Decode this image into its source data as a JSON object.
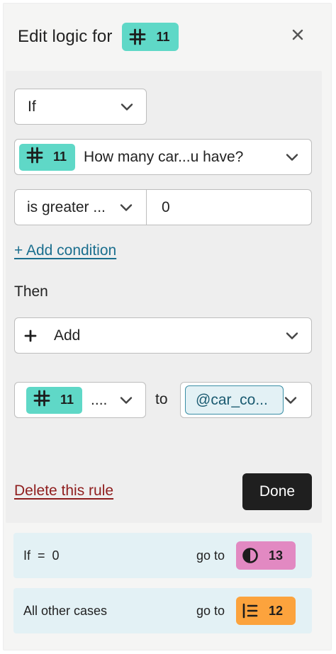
{
  "header": {
    "title": "Edit logic for",
    "question_number": "11",
    "question_icon": "hash-icon",
    "close_icon": "close-icon"
  },
  "rule": {
    "if_select": "If",
    "condition_question": {
      "number": "11",
      "icon": "hash-icon",
      "label": "How many car...u have?"
    },
    "operator": "is greater ...",
    "value": "0",
    "add_condition": "+ Add condition",
    "then_label": "Then",
    "action_add": "Add",
    "action_add_icon": "plus-icon",
    "variable_row": {
      "question_number": "11",
      "question_icon": "hash-icon",
      "field_text": "....",
      "to_label": "to",
      "target_variable": "@car_co..."
    },
    "delete_label": "Delete this rule",
    "done_label": "Done"
  },
  "summaries": [
    {
      "condition": "If  =  0",
      "goto_label": "go to",
      "target_number": "13",
      "target_icon": "half-circle-icon",
      "target_color": "#e289c2"
    },
    {
      "condition": "All other cases",
      "goto_label": "go to",
      "target_number": "12",
      "target_icon": "list-icon",
      "target_color": "#fca33d"
    }
  ],
  "colors": {
    "accent_teal": "#5fd8c7",
    "link_blue": "#1a6e8e",
    "delete_red": "#8f1d1d",
    "done_bg": "#1f1f1f",
    "summary_bg": "#e3f1f5"
  }
}
